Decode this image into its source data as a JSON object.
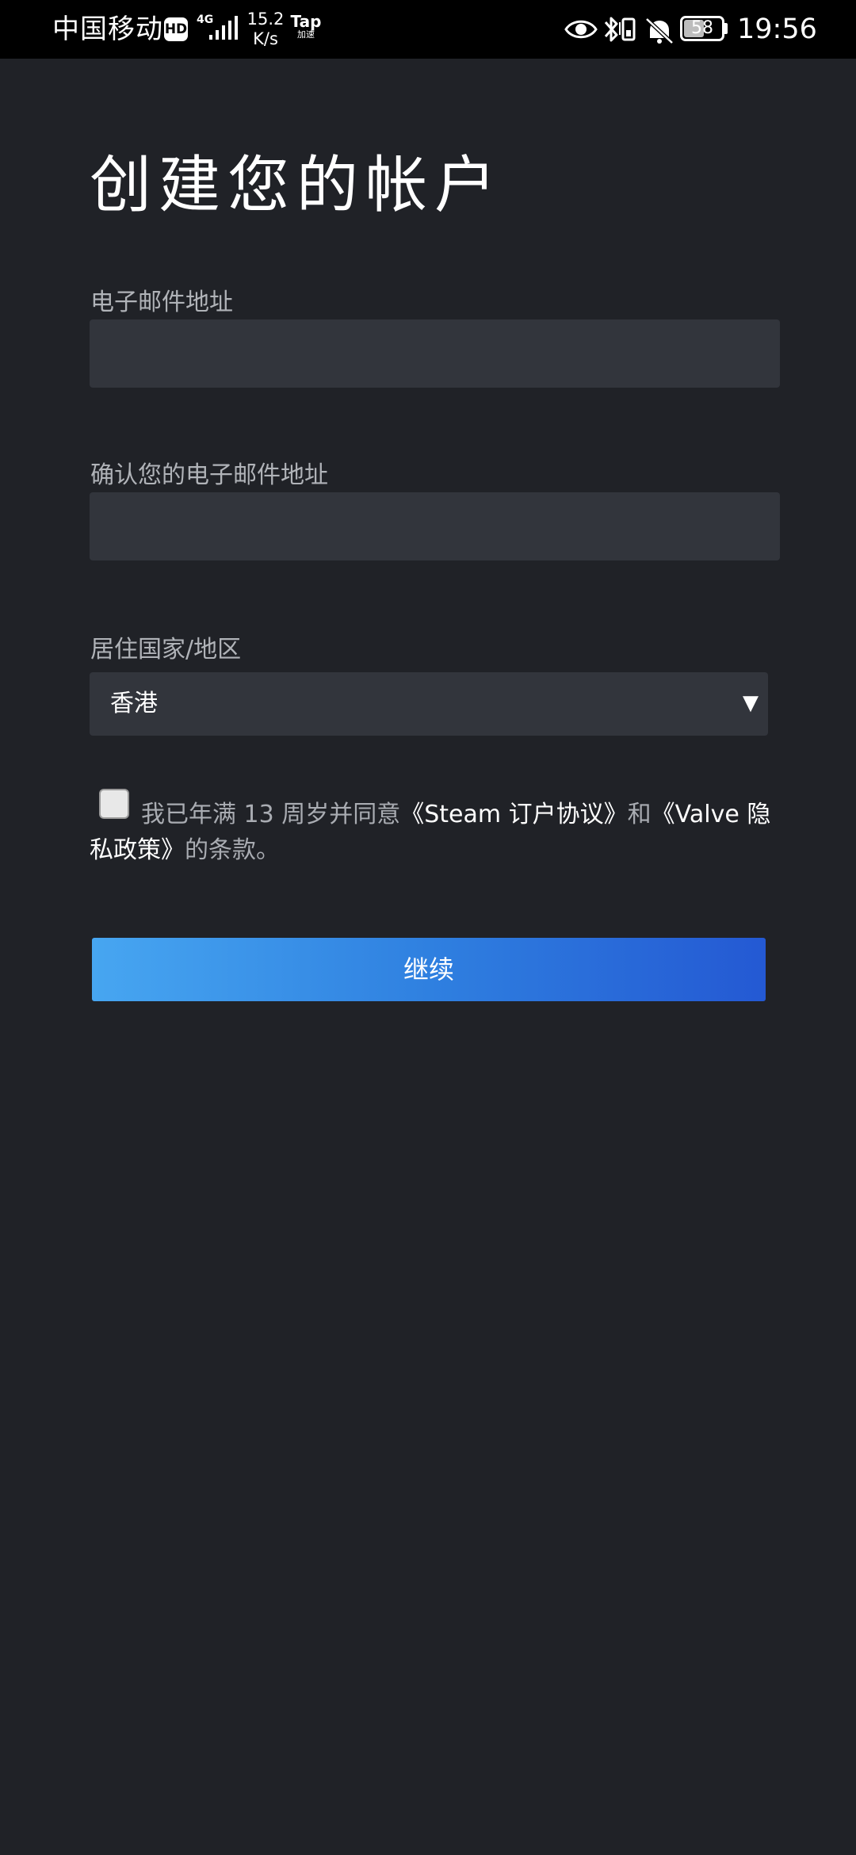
{
  "status_bar": {
    "carrier": "中国移动",
    "hd_badge": "HD",
    "network": "4G",
    "speed_value": "15.2",
    "speed_unit": "K/s",
    "tap_label": "Tap",
    "tap_sub": "加速",
    "icons": [
      "eye-icon",
      "bluetooth-icon",
      "phone-vibrate-icon",
      "bell-off-icon"
    ],
    "battery_percent": 58,
    "battery_text": "58",
    "time": "19:56"
  },
  "page": {
    "title": "创建您的帐户"
  },
  "form": {
    "email": {
      "label": "电子邮件地址",
      "value": "",
      "placeholder": ""
    },
    "confirm_email": {
      "label": "确认您的电子邮件地址",
      "value": "",
      "placeholder": ""
    },
    "country": {
      "label": "居住国家/地区",
      "selected": "香港",
      "arrow": "▼"
    },
    "agreement": {
      "checked": false,
      "prefix": "我已年满 13 周岁并同意",
      "link_steam": "《Steam 订户协议》",
      "middle": "和",
      "link_valve": "《Valve 隐私政策》",
      "suffix": "的条款。"
    },
    "continue_label": "继续"
  },
  "colors": {
    "background": "#202227",
    "input_background": "#32353c",
    "label": "#b0b3b8",
    "button_gradient_start": "#47a6f1",
    "button_gradient_end": "#2459d3"
  }
}
